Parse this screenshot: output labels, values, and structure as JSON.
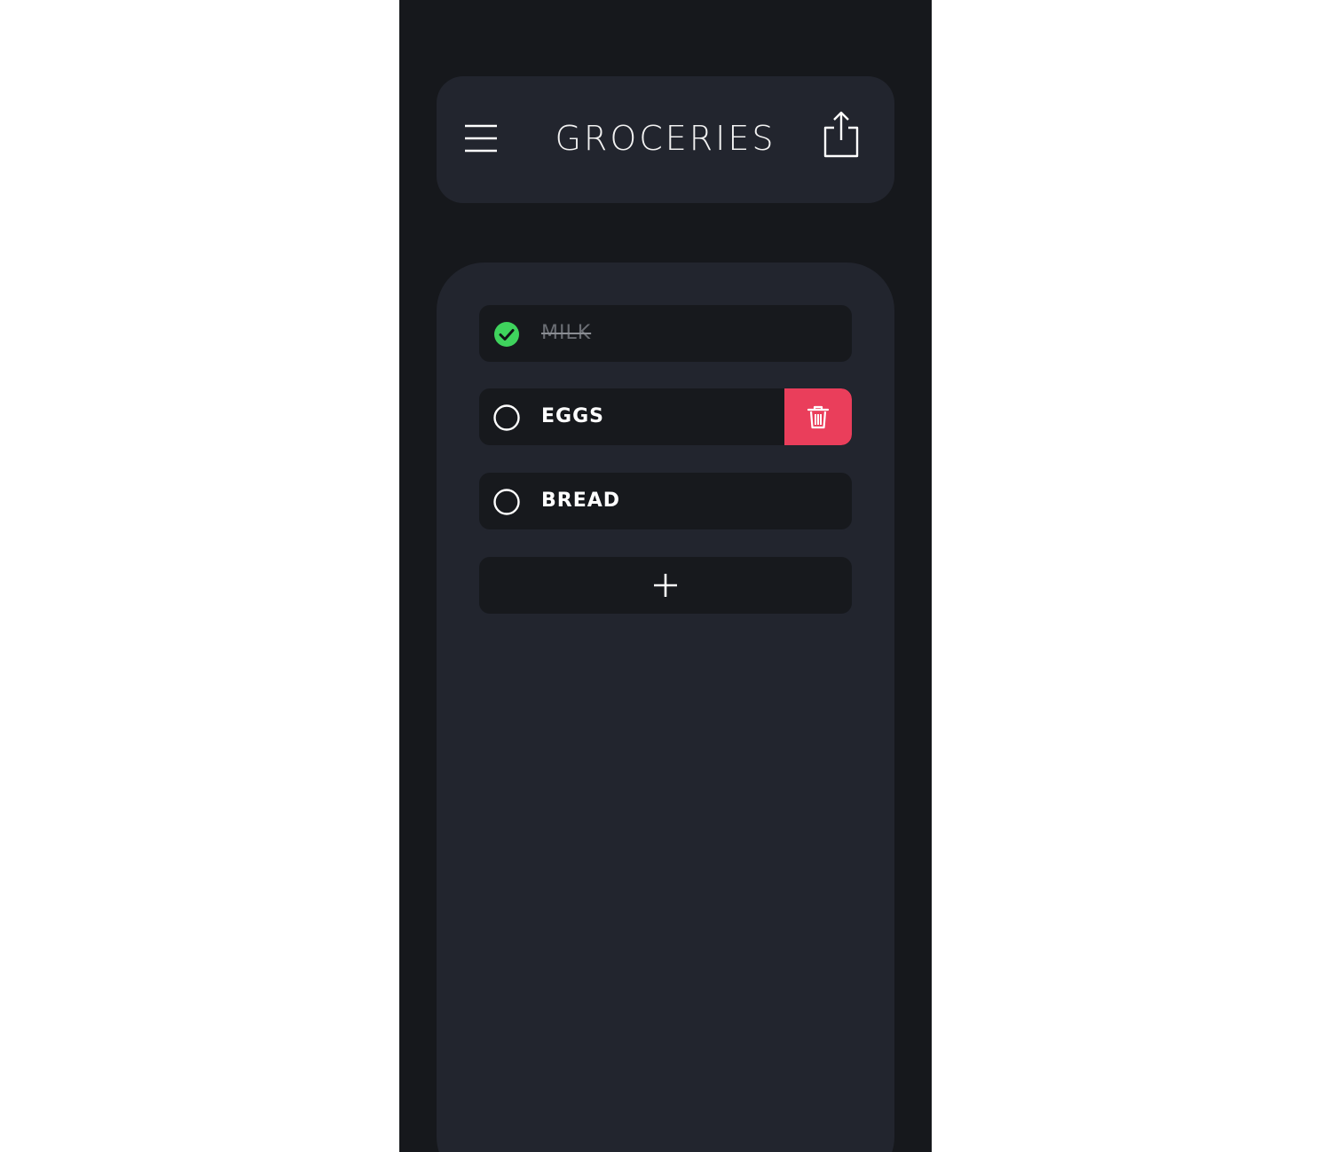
{
  "header": {
    "title": "GROCERIES",
    "menu_icon": "hamburger-menu-icon",
    "share_icon": "share-icon"
  },
  "list": {
    "items": [
      {
        "label": "MILK",
        "checked": true
      },
      {
        "label": "EGGS",
        "checked": false,
        "swiped_delete_visible": true
      },
      {
        "label": "BREAD",
        "checked": false
      }
    ],
    "add_icon": "plus-icon",
    "delete_icon": "trash-icon"
  },
  "colors": {
    "background": "#16181c",
    "card": "#22252e",
    "row": "#17191d",
    "check_green": "#3fd35d",
    "delete_red": "#ea3e5b",
    "text": "#ffffff",
    "text_done": "#6a6d73"
  }
}
